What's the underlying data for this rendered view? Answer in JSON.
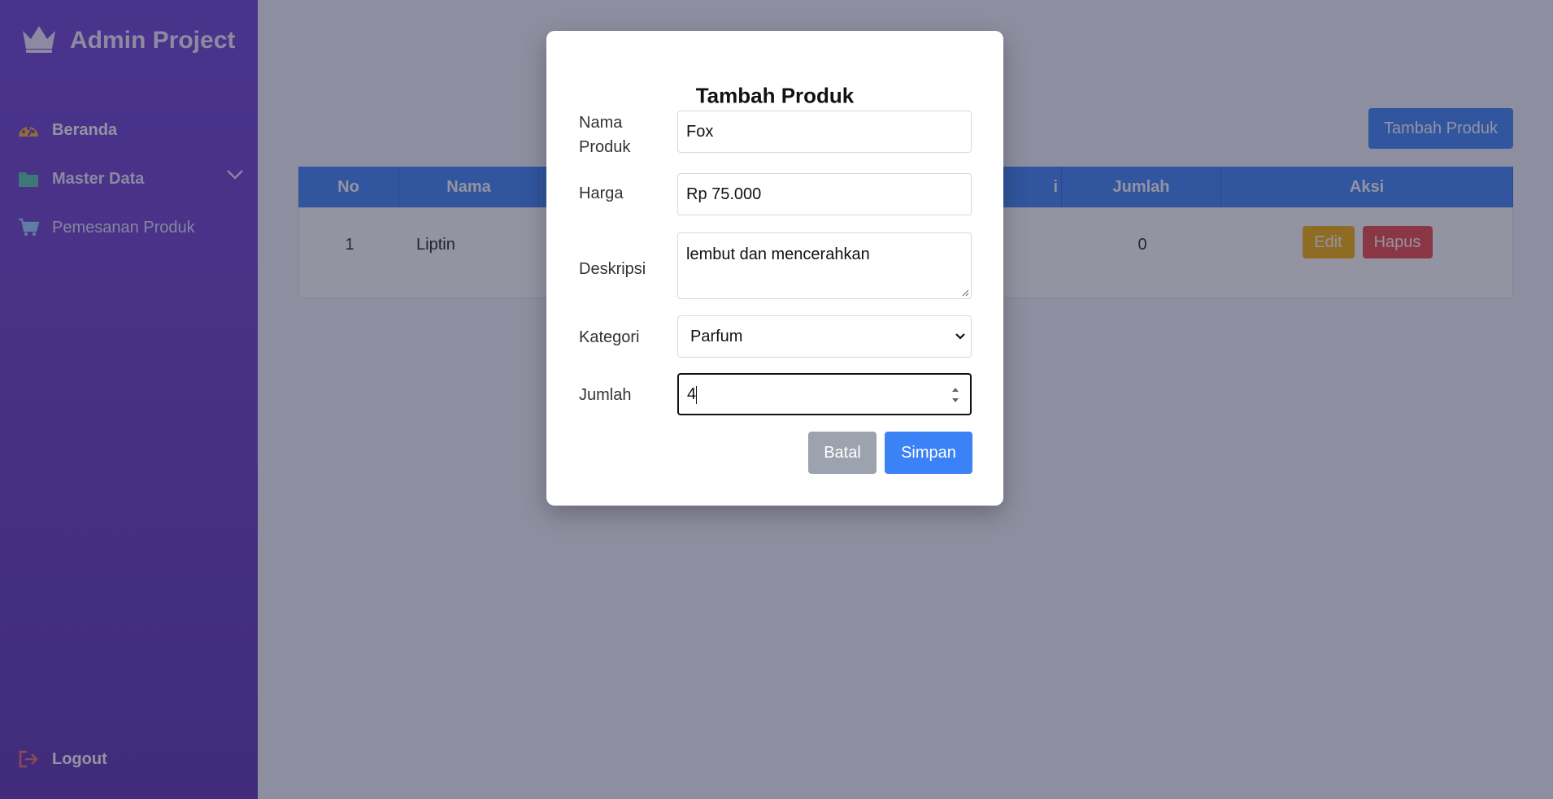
{
  "sidebar": {
    "title": "Admin Project",
    "items": [
      {
        "label": "Beranda"
      },
      {
        "label": "Master Data"
      },
      {
        "label": "Pemesanan Produk"
      }
    ],
    "logout_label": "Logout"
  },
  "main": {
    "add_button_label": "Tambah Produk",
    "table": {
      "headers": [
        "No",
        "Nama",
        "i",
        "Jumlah",
        "Aksi"
      ],
      "rows": [
        {
          "no": "1",
          "nama": "Liptin",
          "jumlah": "0"
        }
      ],
      "edit_label": "Edit",
      "delete_label": "Hapus"
    }
  },
  "modal": {
    "title": "Tambah Produk",
    "fields": {
      "nama_label": "Nama Produk",
      "nama_value": "Fox",
      "harga_label": "Harga",
      "harga_value": "Rp 75.000",
      "deskripsi_label": "Deskripsi",
      "deskripsi_value": "lembut dan mencerahkan",
      "kategori_label": "Kategori",
      "kategori_value": "Parfum",
      "jumlah_label": "Jumlah",
      "jumlah_value": "4"
    },
    "cancel_label": "Batal",
    "save_label": "Simpan"
  },
  "colors": {
    "sidebar": "#6a3bc6",
    "primary": "#3b82f6",
    "warning": "#f5b000",
    "danger": "#ef4444",
    "muted": "#9ca3af"
  },
  "icons": {
    "brand": "crown-icon",
    "beranda": "dashboard-icon",
    "master": "folder-icon",
    "pemesanan": "cart-icon",
    "chevron": "chevron-down-icon",
    "logout": "logout-icon"
  }
}
